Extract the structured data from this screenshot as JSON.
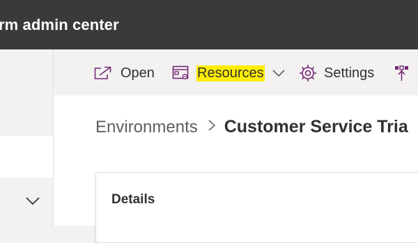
{
  "header": {
    "app_title": "rm admin center"
  },
  "command_bar": {
    "open": "Open",
    "resources": "Resources",
    "settings": "Settings"
  },
  "breadcrumb": {
    "parent": "Environments",
    "current": "Customer Service Tria"
  },
  "details_card": {
    "title": "Details"
  },
  "colors": {
    "topbar": "#3b3a39",
    "accent_purple": "#742774",
    "highlight": "#ffee00",
    "background": "#f3f2f1"
  },
  "icons": [
    "open-icon",
    "resources-icon",
    "chevron-down-icon",
    "settings-icon",
    "app-icon",
    "breadcrumb-separator-icon"
  ]
}
